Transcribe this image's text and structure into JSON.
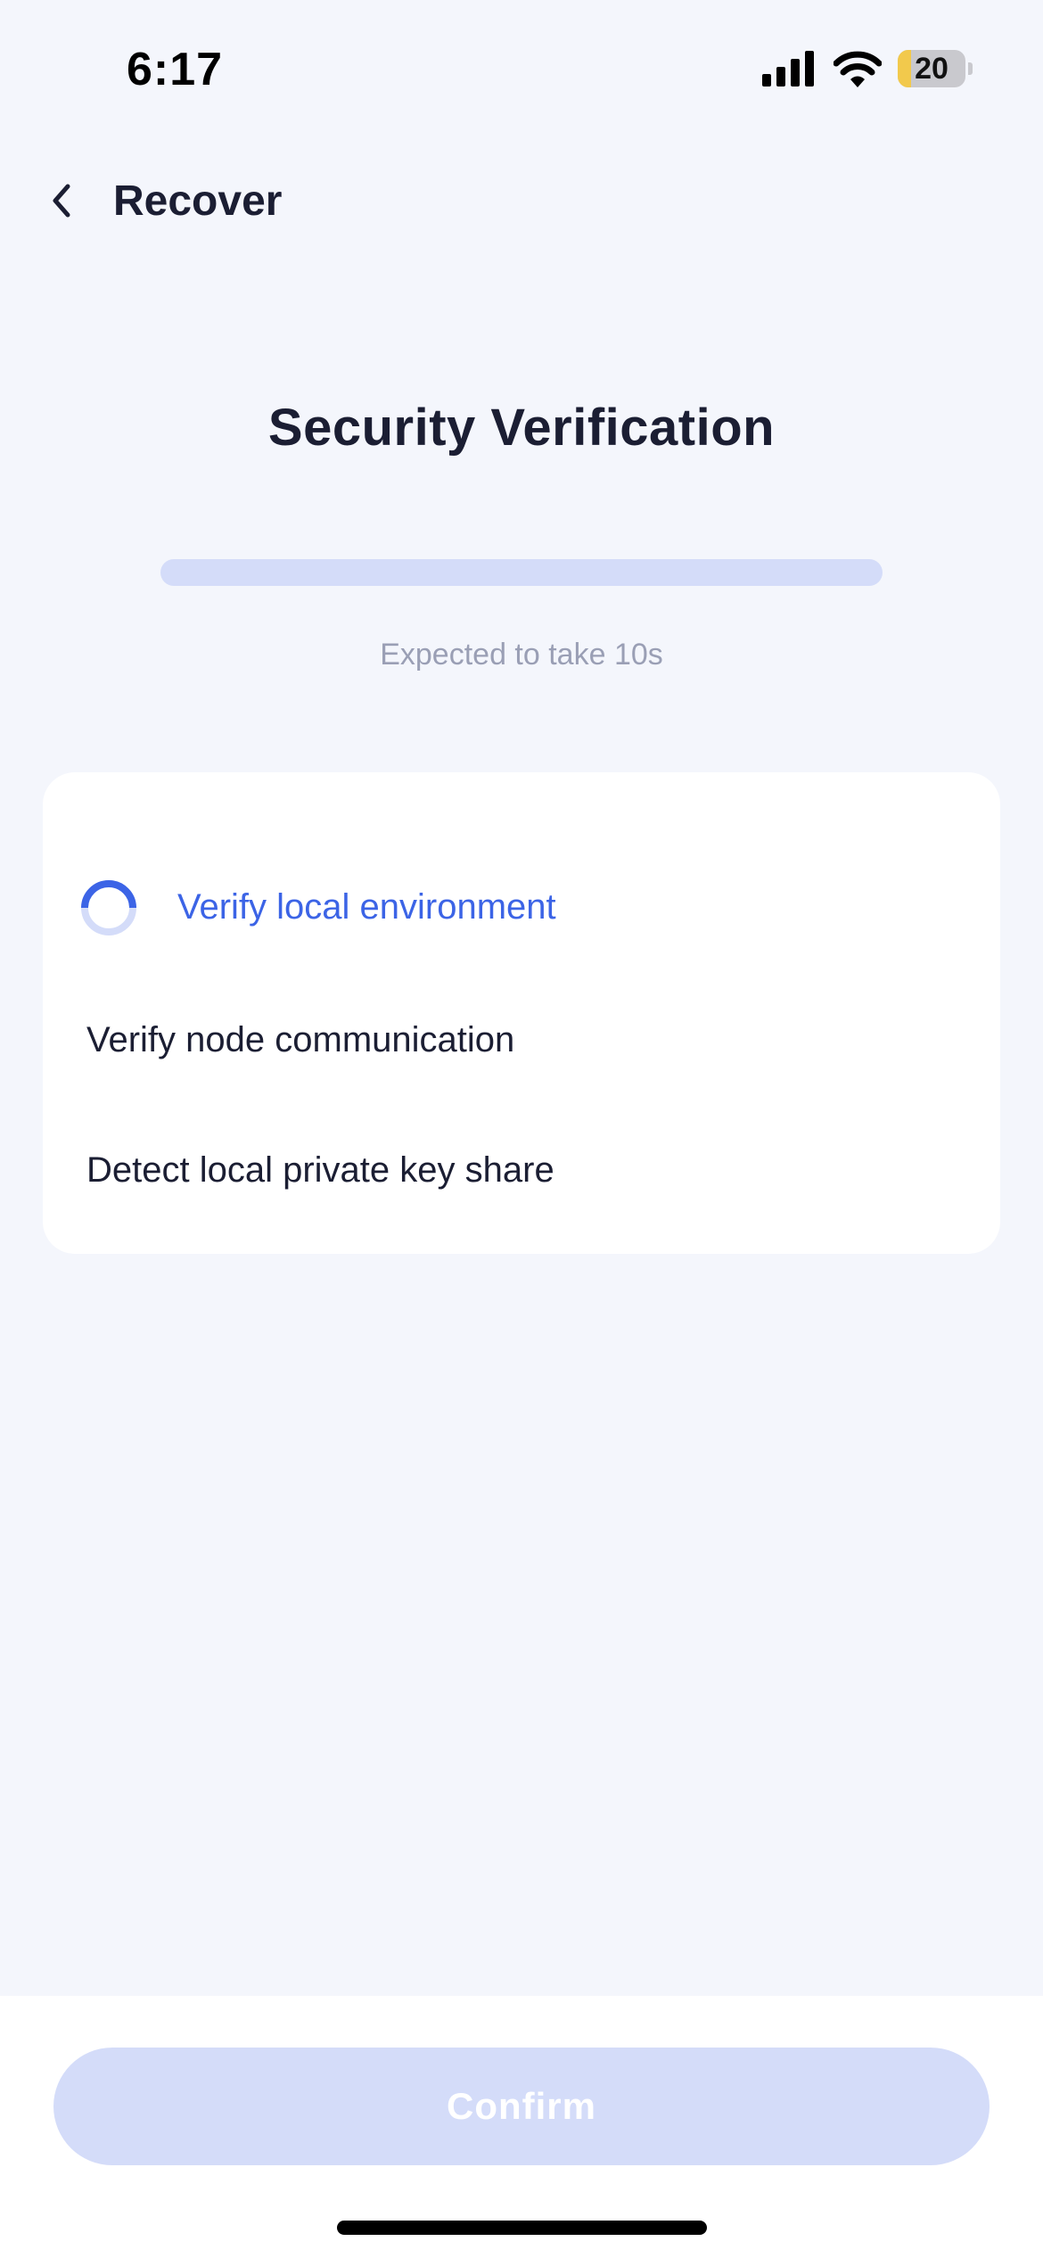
{
  "status_bar": {
    "time": "6:17",
    "battery_level": "20",
    "battery_fill_fraction": 0.2,
    "icons": [
      "cellular-signal-icon",
      "wifi-icon",
      "battery-icon"
    ]
  },
  "nav": {
    "back_icon": "chevron-left-icon",
    "title": "Recover"
  },
  "verification": {
    "title": "Security Verification",
    "progress_fraction": 0,
    "expected_time": "Expected to take 10s"
  },
  "steps": [
    {
      "label": "Verify local environment",
      "state": "in-progress"
    },
    {
      "label": "Verify node communication",
      "state": "pending"
    },
    {
      "label": "Detect local private key share",
      "state": "pending"
    }
  ],
  "footer": {
    "confirm_label": "Confirm",
    "confirm_enabled": false
  },
  "colors": {
    "accent": "#3C64E6",
    "accent_light": "#D4DCF9",
    "background": "#F4F6FC",
    "text_primary": "#1B1E33",
    "text_secondary": "#9A9FB5"
  }
}
